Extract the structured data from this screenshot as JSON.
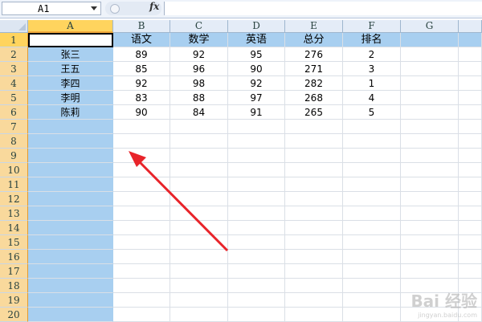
{
  "formula_bar": {
    "name_box": "A1",
    "fx_label": "fx",
    "formula": ""
  },
  "columns": [
    "A",
    "B",
    "C",
    "D",
    "E",
    "F",
    "G"
  ],
  "rows": [
    "1",
    "2",
    "3",
    "4",
    "5",
    "6",
    "7",
    "8",
    "9",
    "10",
    "11",
    "12",
    "13",
    "14",
    "15",
    "16",
    "17",
    "18",
    "19",
    "20"
  ],
  "header_row": [
    "",
    "语文",
    "数学",
    "英语",
    "总分",
    "排名",
    ""
  ],
  "data_rows": [
    [
      "张三",
      "89",
      "92",
      "95",
      "276",
      "2"
    ],
    [
      "王五",
      "85",
      "96",
      "90",
      "271",
      "3"
    ],
    [
      "李四",
      "92",
      "98",
      "92",
      "282",
      "1"
    ],
    [
      "李明",
      "83",
      "88",
      "97",
      "268",
      "4"
    ],
    [
      "陈莉",
      "90",
      "84",
      "91",
      "265",
      "5"
    ]
  ],
  "watermark": {
    "text": "Bai 经验",
    "sub": "jingyan.baidu.com"
  },
  "colors": {
    "selection": "#a8cff0",
    "row_header": "#f9d99c",
    "arrow": "#e8242a"
  }
}
